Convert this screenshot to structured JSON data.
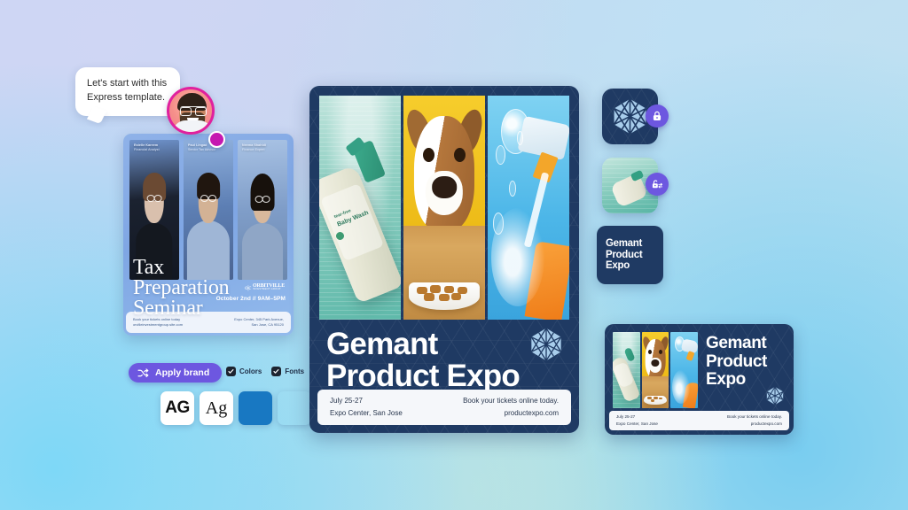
{
  "assistant": {
    "bubble_text": "Let's start with this Express template.",
    "avatar_name": "assistant-avatar"
  },
  "tax_template": {
    "title_line1": "Tax",
    "title_line2": "Preparation",
    "title_line3": "Seminar",
    "date": "October 2nd // 9AM–5PM",
    "brand_mark": "o|c",
    "brand_name": "ORBITVILLE",
    "brand_sub": "INVESTMENT GROUP",
    "people": [
      {
        "name": "Estelle Kareem",
        "role": "Financial Analyst"
      },
      {
        "name": "Paul Lingad",
        "role": "Senior Tax Advisor"
      },
      {
        "name": "Neema Shahidi",
        "role": "Finance Expert"
      }
    ],
    "footer_left_line1": "Book your tickets online today",
    "footer_left_line2": "orvilleinvestmentgroup.site.com",
    "footer_right_line1": "Expo Center, 345 Park Avenue,",
    "footer_right_line2": "San Jose, CA 95120"
  },
  "brand_toolbar": {
    "apply_label": "Apply brand",
    "shuffle_icon": "shuffle-icon",
    "checkboxes": [
      {
        "label": "Colors",
        "checked": true
      },
      {
        "label": "Fonts",
        "checked": true
      }
    ],
    "swatches": [
      {
        "type": "font",
        "label": "AG",
        "style": "sans-bold"
      },
      {
        "type": "font",
        "label": "Ag",
        "style": "serif"
      },
      {
        "type": "color",
        "hex": "#1878c2"
      },
      {
        "type": "texture",
        "hex": "#12355f"
      }
    ]
  },
  "poster": {
    "title_line1": "Gemant",
    "title_line2": "Product Expo",
    "footer_left_line1": "July 25-27",
    "footer_left_line2": "Expo Center, San Jose",
    "footer_right_line1": "Book your tickets online today.",
    "footer_right_line2": "productexpo.com",
    "logo_icon": "polygon-logo-icon",
    "photos": [
      {
        "name": "baby-wash-bottle-photo",
        "caption_small": "tear-free",
        "caption_big": "Baby Wash"
      },
      {
        "name": "dog-with-kibble-photo"
      },
      {
        "name": "spray-bottle-splash-photo"
      }
    ],
    "colors": {
      "navy": "#1f3a63",
      "footer": "#f5f7fa"
    }
  },
  "assets": {
    "logo_tile": {
      "name": "brand-logo-tile",
      "locked": true,
      "badge_icon": "lock-icon"
    },
    "photo_tile": {
      "name": "brand-photo-tile",
      "locked": false,
      "badge_icon": "unlock-swap-icon"
    },
    "text_tile": {
      "name": "brand-text-tile",
      "line1": "Gemant",
      "line2": "Product",
      "line3": "Expo"
    }
  },
  "banner": {
    "title_line1": "Gemant",
    "title_line2": "Product",
    "title_line3": "Expo",
    "footer_left_line1": "July 25-27",
    "footer_left_line2": "Expo Center, San Jose",
    "footer_right_line1": "Book your tickets online today.",
    "footer_right_line2": "productexpo.com"
  },
  "theme": {
    "accent_purple": "#6d57e0",
    "accent_magenta": "#c519b0",
    "navy": "#1f3a63"
  }
}
